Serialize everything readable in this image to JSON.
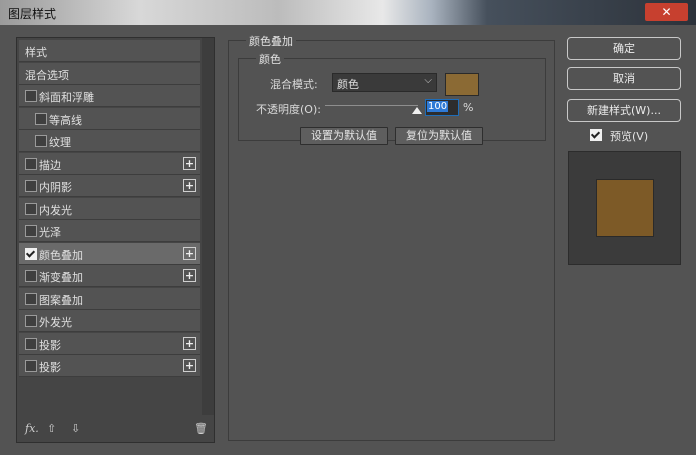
{
  "window": {
    "title": "图层样式",
    "close_label": "✕"
  },
  "sidebar": {
    "items": [
      {
        "label": "样式",
        "checkbox": false,
        "checked": false,
        "plus": false,
        "indent": false,
        "selected": false
      },
      {
        "label": "混合选项",
        "checkbox": false,
        "checked": false,
        "plus": false,
        "indent": false,
        "selected": false
      },
      {
        "label": "斜面和浮雕",
        "checkbox": true,
        "checked": false,
        "plus": false,
        "indent": false,
        "selected": false
      },
      {
        "label": "等高线",
        "checkbox": true,
        "checked": false,
        "plus": false,
        "indent": true,
        "selected": false
      },
      {
        "label": "纹理",
        "checkbox": true,
        "checked": false,
        "plus": false,
        "indent": true,
        "selected": false
      },
      {
        "label": "描边",
        "checkbox": true,
        "checked": false,
        "plus": true,
        "indent": false,
        "selected": false
      },
      {
        "label": "内阴影",
        "checkbox": true,
        "checked": false,
        "plus": true,
        "indent": false,
        "selected": false
      },
      {
        "label": "内发光",
        "checkbox": true,
        "checked": false,
        "plus": false,
        "indent": false,
        "selected": false
      },
      {
        "label": "光泽",
        "checkbox": true,
        "checked": false,
        "plus": false,
        "indent": false,
        "selected": false
      },
      {
        "label": "颜色叠加",
        "checkbox": true,
        "checked": true,
        "plus": true,
        "indent": false,
        "selected": true
      },
      {
        "label": "渐变叠加",
        "checkbox": true,
        "checked": false,
        "plus": true,
        "indent": false,
        "selected": false
      },
      {
        "label": "图案叠加",
        "checkbox": true,
        "checked": false,
        "plus": false,
        "indent": false,
        "selected": false
      },
      {
        "label": "外发光",
        "checkbox": true,
        "checked": false,
        "plus": false,
        "indent": false,
        "selected": false
      },
      {
        "label": "投影",
        "checkbox": true,
        "checked": false,
        "plus": true,
        "indent": false,
        "selected": false
      },
      {
        "label": "投影",
        "checkbox": true,
        "checked": false,
        "plus": true,
        "indent": false,
        "selected": false
      }
    ],
    "footer": {
      "fx": "fx.",
      "up": "⇧",
      "down": "⇩",
      "trash": "🗑"
    }
  },
  "main": {
    "section_title": "颜色叠加",
    "group_title": "颜色",
    "blend_label": "混合模式:",
    "blend_value": "颜色",
    "color_swatch": "#8b6a34",
    "opacity_label": "不透明度(O):",
    "opacity_value": "100",
    "opacity_unit": "%",
    "btn_set_default": "设置为默认值",
    "btn_reset_default": "复位为默认值"
  },
  "actions": {
    "ok": "确定",
    "cancel": "取消",
    "new_style": "新建样式(W)...",
    "preview_label": "预览(V)",
    "preview_checked": true,
    "preview_color": "#7d5a27"
  }
}
